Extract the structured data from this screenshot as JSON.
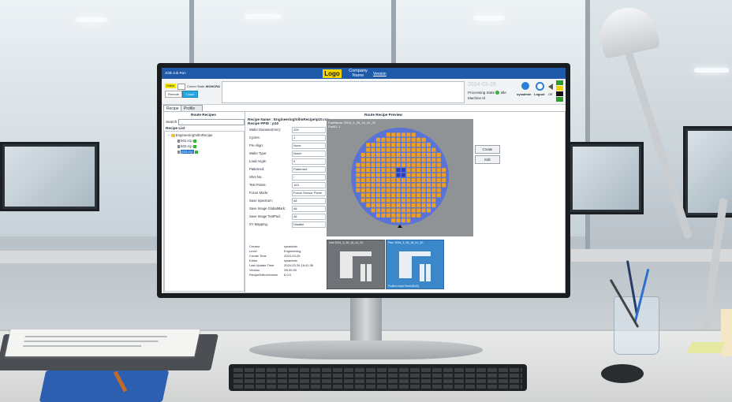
{
  "app": {
    "window_title": "JOB Job Run",
    "logo": "Logo",
    "company": "Company",
    "company_sub": "Name",
    "version": "Version"
  },
  "toolbar": {
    "online": "Online",
    "control_state_label": "Comm State :",
    "control_state_value": "MONCRA",
    "remote": "Remote",
    "local": "Local",
    "date": "2024-03-26",
    "processing_state_label": "Processing State",
    "processing_state_value": "Idle",
    "machine_id": "Machine Id",
    "user": "sysadmin",
    "logout": "Logout",
    "off": "Off"
  },
  "tabs": [
    "Recipe",
    "Profile Manager"
  ],
  "left_panel": {
    "title": "Route Recipes",
    "search_label": "Search:",
    "list_title": "Recipe List",
    "root": "Engineering\\VilmRecipe",
    "items": [
      "b01.rcp",
      "b02.rcp",
      "p10.rcp"
    ],
    "selected_index": 2
  },
  "preview": {
    "title": "Route Recipe Preview",
    "recipe_name_label": "Recipe Name :",
    "recipe_name": "Engineering\\VilmRecipe\\p10.rcp",
    "recipe_ppid_label": "Recipe PPID :",
    "recipe_ppid": "p10",
    "image_line1": "PadName: 2024_3_26_18_41_20",
    "image_line2": "PadID: 1",
    "thumb_a": "Unk 2024_3_26_18_41_20",
    "thumb_b": "Pad: 2024_3_26_18_41_20",
    "thumb_b_foot": "Profiles recipe/TestUI(BND)"
  },
  "params": [
    {
      "label": "Wafer Diameter(mm):",
      "value": "200"
    },
    {
      "label": "Cycles:",
      "value": "1"
    },
    {
      "label": "Pre Align:",
      "value": "None"
    },
    {
      "label": "Wafer Type:",
      "value": "Notch"
    },
    {
      "label": "Load Angle:",
      "value": "0"
    },
    {
      "label": "Patterned:",
      "value": "Patterned"
    },
    {
      "label": "Shot No.:",
      "value": "/"
    },
    {
      "label": "Test Points:",
      "value": "143"
    },
    {
      "label": "Focus Mode:",
      "value": "Focus Sensor Plane"
    },
    {
      "label": "Save Spectrum:",
      "value": "All"
    },
    {
      "label": "Save Image GlobalMark:",
      "value": "All"
    },
    {
      "label": "Save Image TestPad:",
      "value": "All"
    },
    {
      "label": "XY Mapping:",
      "value": "Disable"
    }
  ],
  "info": [
    {
      "label": "Creator",
      "value": "sysadmin"
    },
    {
      "label": "Level",
      "value": "Engineering"
    },
    {
      "label": "Create Time",
      "value": "2024-03-26"
    },
    {
      "label": "Editor",
      "value": "sysadmin"
    },
    {
      "label": "Last Update Time",
      "value": "2024-03-26 18:41:36"
    },
    {
      "label": "Version",
      "value": "V6.00.00"
    },
    {
      "label": "RecipeEditorVersion",
      "value": "6.0.0"
    }
  ],
  "buttons": {
    "create": "Create",
    "edit": "Edit"
  },
  "colors": {
    "title_bar": "#1e5aa8",
    "logo_yellow": "#f2d500",
    "die_orange": "#f0a020",
    "die_blue": "#2f3fb8",
    "wafer_blue": "#5a73d6",
    "selected_blue": "#1f6fd6",
    "status_green": "#3caa3c"
  }
}
